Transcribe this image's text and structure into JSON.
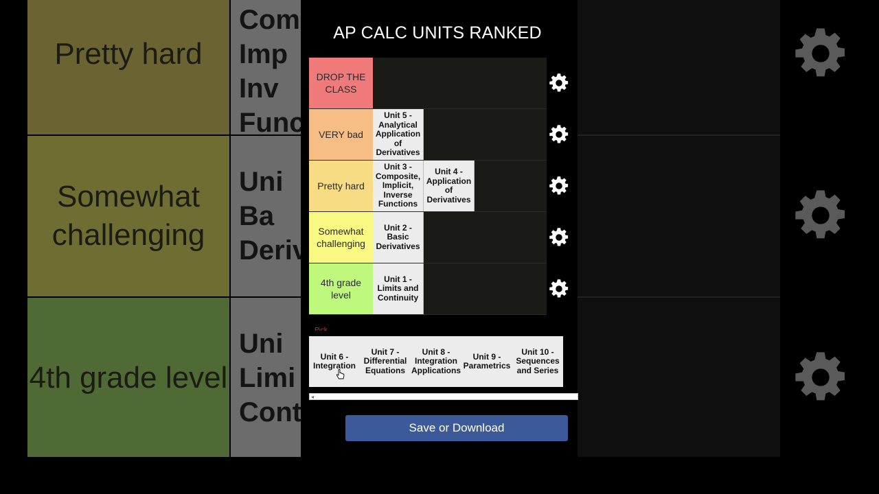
{
  "title": "AP CALC UNITS RANKED",
  "tiers": [
    {
      "label": "DROP THE CLASS",
      "color": "#f07a7a",
      "items": []
    },
    {
      "label": "VERY bad",
      "color": "#f6bd84",
      "items": [
        "Unit 5 - Analytical Application of Derivatives"
      ]
    },
    {
      "label": "Pretty hard",
      "color": "#f8dc84",
      "items": [
        "Unit 3 - Composite, Implicit, Inverse Functions",
        "Unit 4 - Application of Derivatives"
      ]
    },
    {
      "label": "Somewhat challenging",
      "color": "#f8f882",
      "items": [
        "Unit 2 - Basic Derivatives"
      ]
    },
    {
      "label": "4th grade level",
      "color": "#bef87c",
      "items": [
        "Unit 1 - Limits and Continuity"
      ]
    }
  ],
  "pool": {
    "label": "Pick",
    "items": [
      "Unit 6 - Integration",
      "Unit 7 - Differential Equations",
      "Unit 8 - Integration Applications",
      "Unit 9 - Parametrics",
      "Unit 10 - Sequences and Series"
    ]
  },
  "save_button": "Save or Download",
  "background": {
    "rows": [
      {
        "label": "Pretty hard",
        "cell": "Uni\nComp\nImp\nInv\nFunc",
        "color": "#6b6432"
      },
      {
        "label": "Somewhat challenging",
        "cell": "Uni\nBa\nDeriv",
        "color": "#6e6e32"
      },
      {
        "label": "4th grade level",
        "cell": "Uni\nLimi\nCont",
        "color": "#4f6a34"
      }
    ]
  },
  "icons": {
    "tier_settings": "gear-icon",
    "cursor": "hand-pointer-icon"
  }
}
